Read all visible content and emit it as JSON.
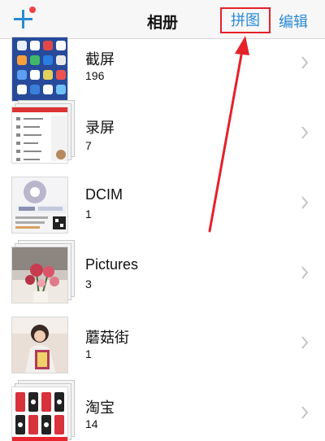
{
  "navbar": {
    "title": "相册",
    "puzzle_label": "拼图",
    "edit_label": "编辑"
  },
  "albums": [
    {
      "name": "截屏",
      "count": "196"
    },
    {
      "name": "录屏",
      "count": "7"
    },
    {
      "name": "DCIM",
      "count": "1"
    },
    {
      "name": "Pictures",
      "count": "3"
    },
    {
      "name": "蘑菇街",
      "count": "1"
    },
    {
      "name": "淘宝",
      "count": "14"
    }
  ],
  "colors": {
    "accent": "#2a8bd6",
    "annotation_red": "#e5212a",
    "badge_red": "#ef4343",
    "chevron": "#c4c4c4"
  },
  "icons": [
    "add-icon",
    "chevron-right-icon"
  ]
}
